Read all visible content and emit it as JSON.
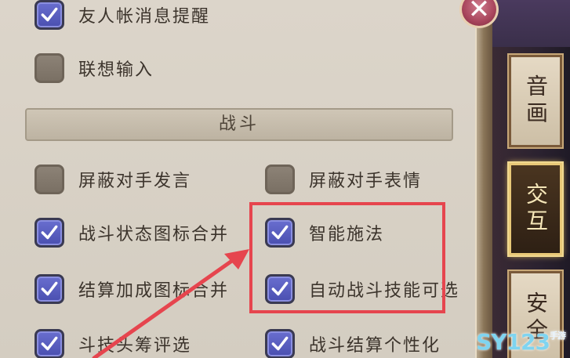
{
  "settings": {
    "friend_msg_label": "友人帐消息提醒",
    "assoc_input_label": "联想输入",
    "battle_section": "战斗",
    "mute_opp_chat_label": "屏蔽对手发言",
    "mute_opp_emote_label": "屏蔽对手表情",
    "battle_status_icon_label": "战斗状态图标合并",
    "smart_cast_label": "智能施法",
    "settle_bonus_icon_label": "结算加成图标合并",
    "auto_battle_skill_label": "自动战斗技能可选",
    "arena_rating_label": "斗技头筹评选",
    "battle_result_custom_label": "战斗结算个性化"
  },
  "sidebar": {
    "tab_sound": "音画",
    "tab_interact": "交互",
    "tab_security": "安全"
  },
  "close_symbol": "✕",
  "watermark": {
    "main": "SY123",
    "small": "手游"
  },
  "colors": {
    "checked": "#5a5fc2",
    "unchecked": "#807668",
    "highlight": "#e6454e"
  }
}
